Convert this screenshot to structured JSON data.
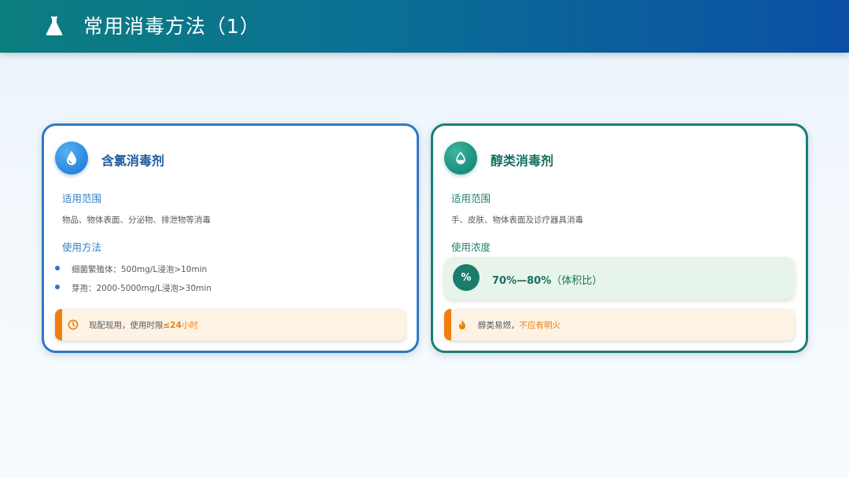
{
  "header": {
    "title": "常用消毒方法（1）",
    "icon": "flask-icon"
  },
  "left_card": {
    "title": "含氯消毒剂",
    "icon": "water-drop-icon",
    "accent": "#2e78c7",
    "scope_heading": "适用范围",
    "scope_text": "物品、物体表面、分泌物、排泄物等消毒",
    "method_heading": "使用方法",
    "methods": [
      "细菌繁殖体：500mg/L浸泡>10min",
      "芽孢：2000-5000mg/L浸泡>30min"
    ],
    "notice_icon": "clock-icon",
    "notice_prefix": "现配现用，使用时限",
    "notice_emphasis": "≤24",
    "notice_suffix": "小时"
  },
  "right_card": {
    "title": "醇类消毒剂",
    "icon": "drop-in-circle-icon",
    "accent": "#1a7f72",
    "scope_heading": "适用范围",
    "scope_text": "手、皮肤、物体表面及诊疗器具消毒",
    "concentration_heading": "使用浓度",
    "concentration_symbol": "%",
    "concentration_value": "70%—80%",
    "concentration_unit": "（体积比）",
    "notice_icon": "fire-icon",
    "notice_prefix": "醇类易燃，",
    "notice_emphasis": "不应有明火"
  }
}
